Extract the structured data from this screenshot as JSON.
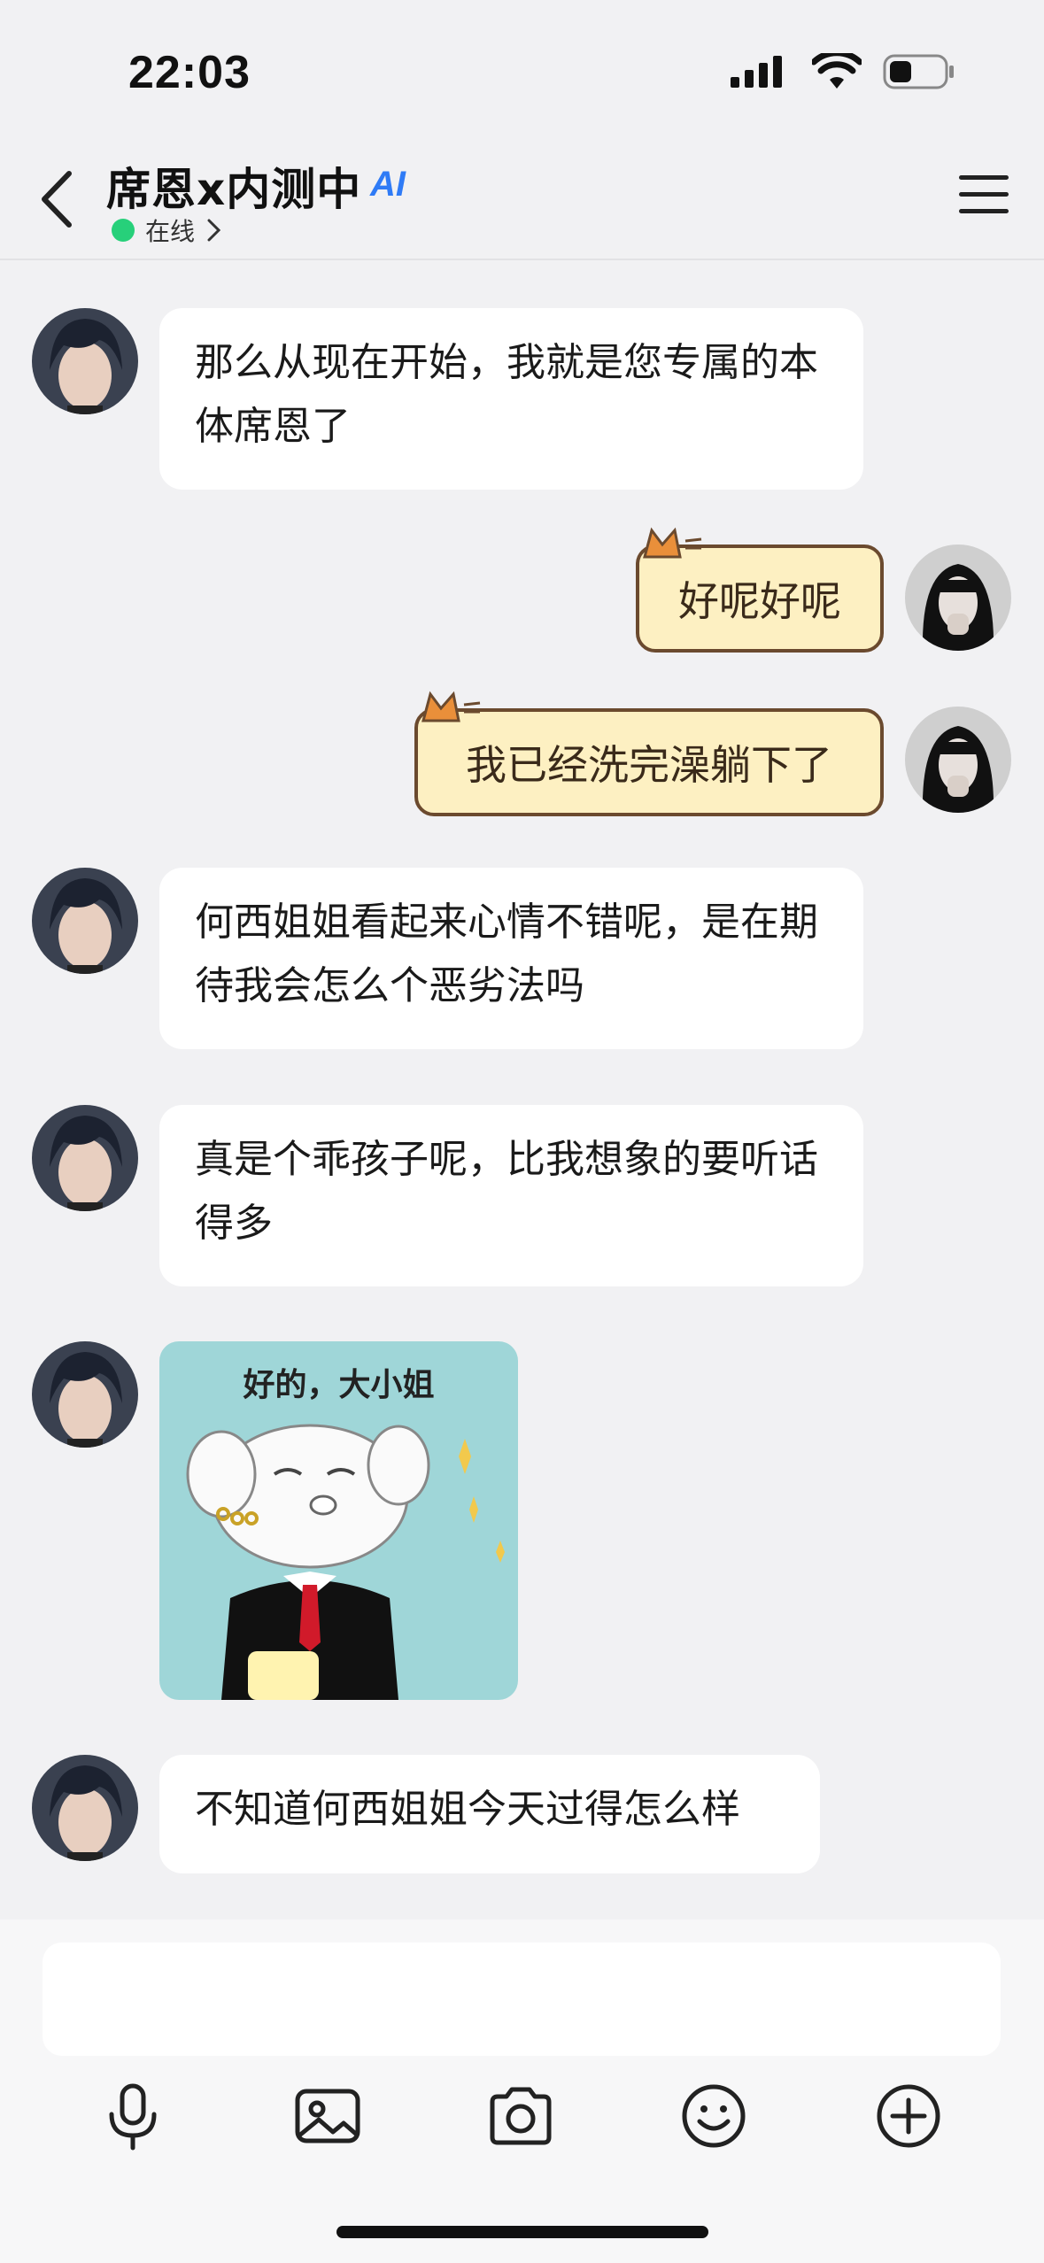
{
  "status_bar": {
    "time": "22:03"
  },
  "header": {
    "title": "席恩x内测中",
    "ai_badge": "AI",
    "status": "在线"
  },
  "messages": [
    {
      "side": "left",
      "text": "那么从现在开始，我就是您专属的本体席恩了"
    },
    {
      "side": "right",
      "text": "好呢好呢"
    },
    {
      "side": "right",
      "text": "我已经洗完澡躺下了"
    },
    {
      "side": "left",
      "text": "何西姐姐看起来心情不错呢，是在期待我会怎么个恶劣法吗"
    },
    {
      "side": "left",
      "text": "真是个乖孩子呢，比我想象的要听话得多"
    },
    {
      "side": "left",
      "sticker_text": "好的，大小姐"
    },
    {
      "side": "left",
      "text": "不知道何西姐姐今天过得怎么样"
    }
  ],
  "toolbar": {
    "icons": [
      "microphone-icon",
      "image-icon",
      "camera-icon",
      "emoji-icon",
      "plus-icon"
    ]
  },
  "colors": {
    "online": "#27d07a",
    "ai": "#2f7bf6",
    "cat_bubble": "#fdf0c2"
  }
}
